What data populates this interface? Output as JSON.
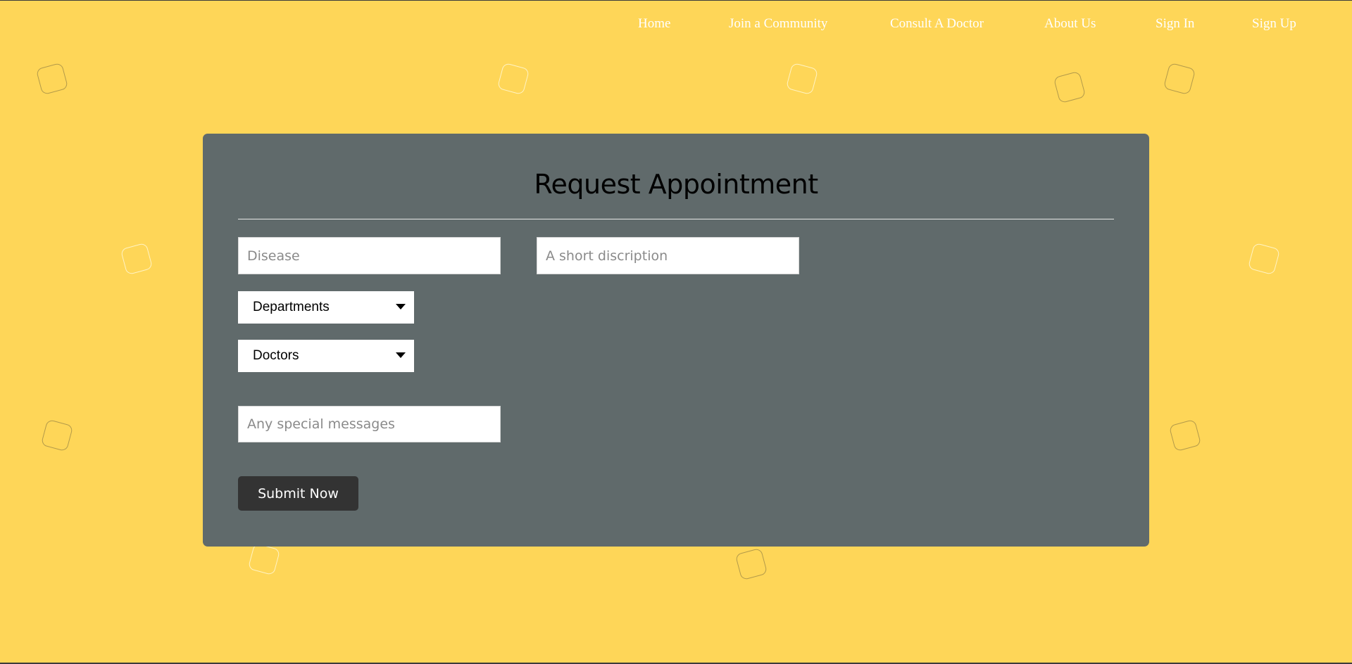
{
  "nav": {
    "home": "Home",
    "community": "Join a Community",
    "consult": "Consult A Doctor",
    "about": "About Us",
    "signin": "Sign In",
    "signup": "Sign Up"
  },
  "form": {
    "title": "Request Appointment",
    "disease_placeholder": "Disease",
    "description_placeholder": "A short discription",
    "departments_label": "Departments",
    "doctors_label": "Doctors",
    "messages_placeholder": "Any special messages",
    "submit_label": "Submit Now"
  },
  "colors": {
    "background": "#fed658",
    "card": "#606a6b",
    "button": "#333333"
  },
  "icons": [
    "rounded-square-outline"
  ]
}
